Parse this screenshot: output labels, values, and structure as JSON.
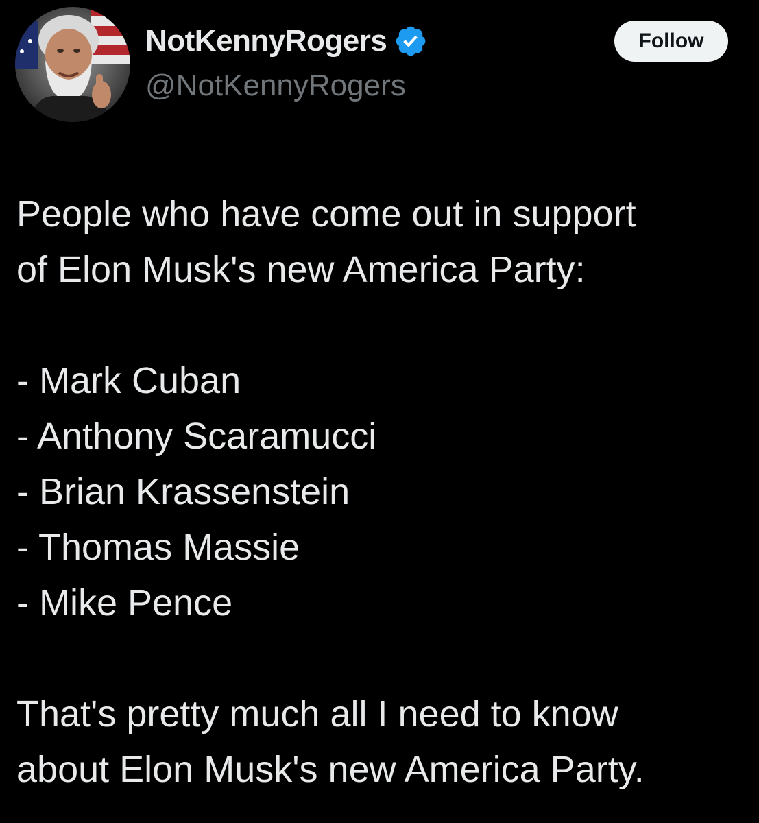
{
  "tweet": {
    "display_name": "NotKennyRogers",
    "handle": "@NotKennyRogers",
    "verified_icon": "verified-badge-icon",
    "follow_label": "Follow",
    "body": {
      "intro_line_1": "People who have come out in support",
      "intro_line_2": "of Elon Musk's new America Party:",
      "list": [
        "- Mark Cuban",
        "- Anthony Scaramucci",
        "- Brian Krassenstein",
        "- Thomas Massie",
        "- Mike Pence"
      ],
      "outro_line_1": "That's pretty much all I need to know",
      "outro_line_2": "about Elon Musk's new America Party."
    }
  },
  "colors": {
    "background": "#000000",
    "primary_text": "#e7e9ea",
    "secondary_text": "#71767b",
    "verified_blue": "#1d9bf0",
    "follow_bg": "#eff3f4",
    "follow_text": "#0f1419"
  }
}
